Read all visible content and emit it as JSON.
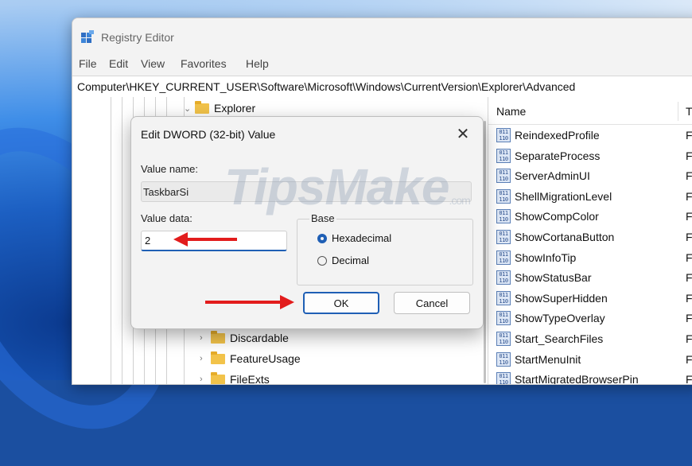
{
  "window": {
    "title": "Registry Editor",
    "menu": [
      "File",
      "Edit",
      "View",
      "Favorites",
      "Help"
    ],
    "address": "Computer\\HKEY_CURRENT_USER\\Software\\Microsoft\\Windows\\CurrentVersion\\Explorer\\Advanced"
  },
  "tree": {
    "expanded_item": "Explorer",
    "items": [
      "Discardable",
      "FeatureUsage",
      "FileExts"
    ]
  },
  "list": {
    "columns": {
      "name": "Name",
      "type": "T"
    },
    "rows": [
      {
        "name": "ReindexedProfile",
        "type": "F"
      },
      {
        "name": "SeparateProcess",
        "type": "F"
      },
      {
        "name": "ServerAdminUI",
        "type": "F"
      },
      {
        "name": "ShellMigrationLevel",
        "type": "F"
      },
      {
        "name": "ShowCompColor",
        "type": "F"
      },
      {
        "name": "ShowCortanaButton",
        "type": "F"
      },
      {
        "name": "ShowInfoTip",
        "type": "F"
      },
      {
        "name": "ShowStatusBar",
        "type": "F"
      },
      {
        "name": "ShowSuperHidden",
        "type": "F"
      },
      {
        "name": "ShowTypeOverlay",
        "type": "F"
      },
      {
        "name": "Start_SearchFiles",
        "type": "F"
      },
      {
        "name": "StartMenuInit",
        "type": "F"
      },
      {
        "name": "StartMigratedBrowserPin",
        "type": "F"
      }
    ],
    "icon_glyph": "011\n110"
  },
  "dialog": {
    "title": "Edit DWORD (32-bit) Value",
    "close_glyph": "✕",
    "value_name_label": "Value name:",
    "value_name": "TaskbarSi",
    "value_data_label": "Value data:",
    "value_data": "2",
    "base_label": "Base",
    "hex_label": "Hexadecimal",
    "dec_label": "Decimal",
    "selected_base": "Hexadecimal",
    "ok_label": "OK",
    "cancel_label": "Cancel"
  },
  "watermark": {
    "main": "TipsMake",
    "suffix": ".com"
  },
  "colors": {
    "accent": "#1f5fb5",
    "arrow": "#e21c1c",
    "folder": "#f2c34a"
  },
  "icons": [
    "registry-editor-icon",
    "chevron-down-icon",
    "chevron-right-icon",
    "folder-icon",
    "reg-dword-icon",
    "close-icon",
    "red-arrow-icon"
  ]
}
